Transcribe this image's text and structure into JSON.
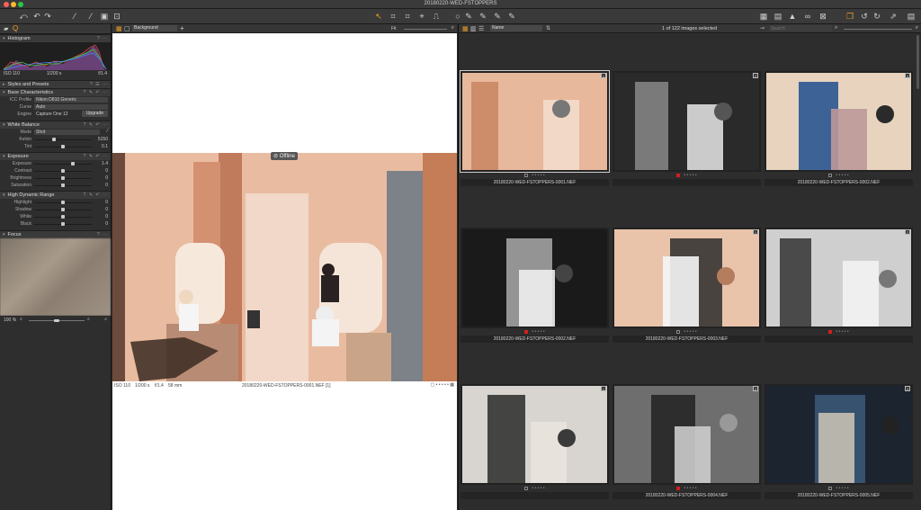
{
  "window": {
    "title": "20180220-WED-FSTOPPERS"
  },
  "left_panel": {
    "histogram": {
      "title": "Histogram",
      "iso": "ISO 110",
      "shutter": "1/200 s",
      "aperture": "f/1.4"
    },
    "styles": {
      "title": "Styles and Presets"
    },
    "base": {
      "title": "Base Characteristics",
      "icc_label": "ICC Profile",
      "icc_value": "Nikon D810 Generic",
      "curve_label": "Curve",
      "curve_value": "Auto",
      "engine_label": "Engine",
      "engine_value": "Capture One 12",
      "upgrade": "Upgrade"
    },
    "wb": {
      "title": "White Balance",
      "mode_label": "Mode",
      "mode_value": "Shot",
      "kelvin_label": "Kelvin",
      "kelvin_value": "5150",
      "tint_label": "Tint",
      "tint_value": "0.1"
    },
    "exposure": {
      "title": "Exposure",
      "rows": [
        {
          "label": "Exposure",
          "value": "1.4",
          "pos": 0.68
        },
        {
          "label": "Contrast",
          "value": "0",
          "pos": 0.5
        },
        {
          "label": "Brightness",
          "value": "0",
          "pos": 0.5
        },
        {
          "label": "Saturation",
          "value": "0",
          "pos": 0.5
        }
      ]
    },
    "hdr": {
      "title": "High Dynamic Range",
      "rows": [
        {
          "label": "Highlight",
          "value": "0",
          "pos": 0.5
        },
        {
          "label": "Shadow",
          "value": "0",
          "pos": 0.5
        },
        {
          "label": "White",
          "value": "0",
          "pos": 0.5
        },
        {
          "label": "Black",
          "value": "0",
          "pos": 0.5
        }
      ]
    },
    "focus": {
      "title": "Focus",
      "zoom": "100 %"
    }
  },
  "viewer": {
    "layer": "Background",
    "fit": "Fit",
    "offline": "Offline",
    "iso": "ISO 110",
    "shutter": "1/200 s",
    "aperture": "f/1.4",
    "focal": "58 mm",
    "filename": "20180220-WED-FSTOPPERS-0001.NEF [1]"
  },
  "browser": {
    "sort": "Name",
    "status": "1 of 122 images selected",
    "search_placeholder": "Search",
    "thumbs": [
      {
        "name": "20180220-WED-FSTOPPERS-0001.NEF",
        "badge": "1",
        "red": false,
        "sel": true
      },
      {
        "name": "",
        "badge": "2",
        "red": true,
        "sel": false
      },
      {
        "name": "20180220-WED-FSTOPPERS-0002.NEF",
        "badge": "3",
        "red": false,
        "sel": false
      },
      {
        "name": "20180220-WED-FSTOPPERS-0002.NEF",
        "badge": "",
        "red": true,
        "sel": false
      },
      {
        "name": "20180220-WED-FSTOPPERS-0003.NEF",
        "badge": "1",
        "red": false,
        "sel": false
      },
      {
        "name": "",
        "badge": "2",
        "red": true,
        "sel": false
      },
      {
        "name": "",
        "badge": "1",
        "red": false,
        "sel": false
      },
      {
        "name": "20180220-WED-FSTOPPERS-0004.NEF",
        "badge": "2",
        "red": true,
        "sel": false
      },
      {
        "name": "20180220-WED-FSTOPPERS-0005.NEF",
        "badge": "3",
        "red": false,
        "sel": false
      }
    ]
  }
}
